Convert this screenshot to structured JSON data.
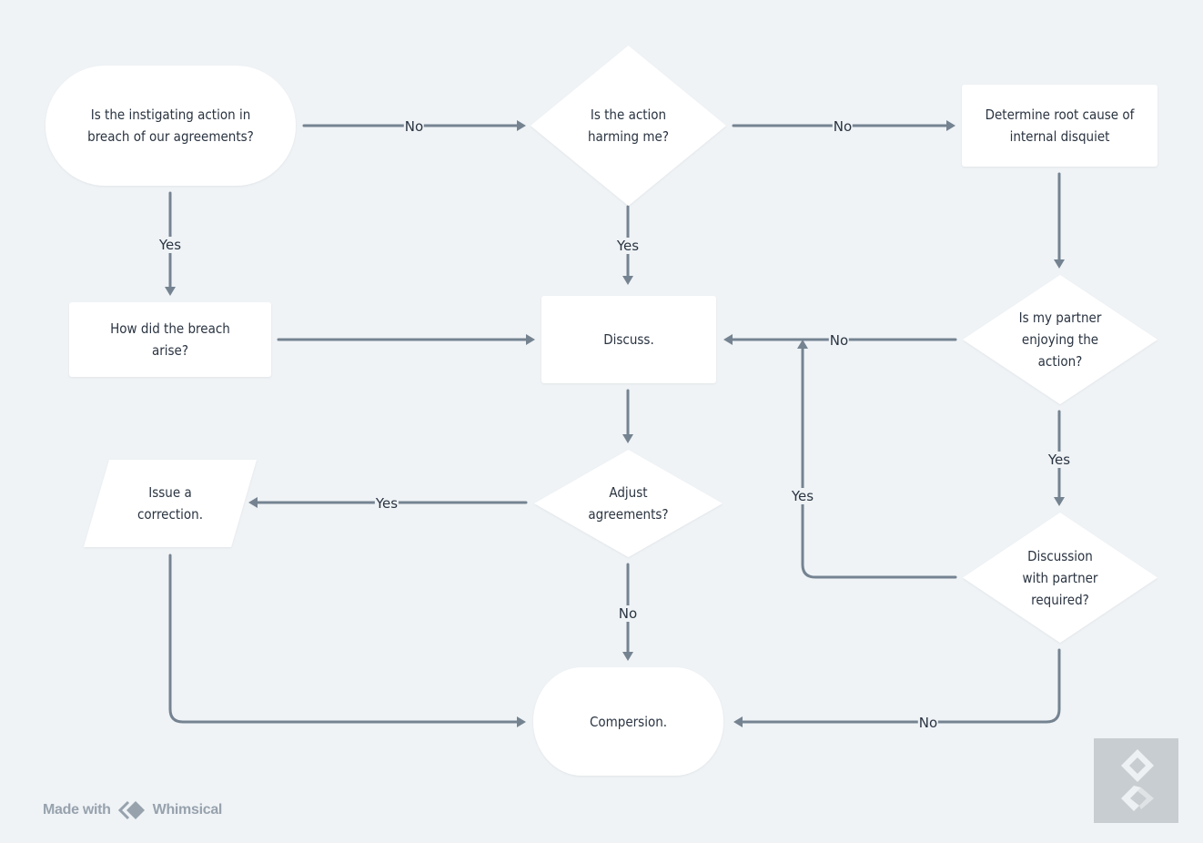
{
  "diagram": {
    "type": "flowchart",
    "colors": {
      "background": "#eff3f6",
      "node_fill": "#ffffff",
      "edge": "#758391",
      "text": "#2a3441"
    },
    "nodes": [
      {
        "id": "n1",
        "shape": "terminal",
        "label": "Is the instigating action in\nbreach of our agreements?"
      },
      {
        "id": "n2",
        "shape": "decision",
        "label": "Is the action\nharming me?"
      },
      {
        "id": "n3",
        "shape": "process",
        "label": "Determine root cause of\ninternal disquiet"
      },
      {
        "id": "n4",
        "shape": "process",
        "label": "How did the breach\narise?"
      },
      {
        "id": "n5",
        "shape": "process",
        "label": "Discuss."
      },
      {
        "id": "n6",
        "shape": "decision",
        "label": "Is my partner\nenjoying the\naction?"
      },
      {
        "id": "n7",
        "shape": "io",
        "label": "Issue a\ncorrection."
      },
      {
        "id": "n8",
        "shape": "decision",
        "label": "Adjust\nagreements?"
      },
      {
        "id": "n9",
        "shape": "decision",
        "label": "Discussion\nwith partner\nrequired?"
      },
      {
        "id": "n10",
        "shape": "terminal",
        "label": "Compersion."
      }
    ],
    "edges": [
      {
        "from": "n1",
        "to": "n2",
        "label": "No"
      },
      {
        "from": "n1",
        "to": "n4",
        "label": "Yes"
      },
      {
        "from": "n2",
        "to": "n3",
        "label": "No"
      },
      {
        "from": "n2",
        "to": "n5",
        "label": "Yes"
      },
      {
        "from": "n3",
        "to": "n6",
        "label": ""
      },
      {
        "from": "n4",
        "to": "n5",
        "label": ""
      },
      {
        "from": "n6",
        "to": "n5",
        "label": "No"
      },
      {
        "from": "n6",
        "to": "n9",
        "label": "Yes"
      },
      {
        "from": "n5",
        "to": "n8",
        "label": ""
      },
      {
        "from": "n8",
        "to": "n7",
        "label": "Yes"
      },
      {
        "from": "n8",
        "to": "n10",
        "label": "No"
      },
      {
        "from": "n9",
        "to": "n5",
        "label": "Yes"
      },
      {
        "from": "n9",
        "to": "n10",
        "label": "No"
      },
      {
        "from": "n7",
        "to": "n10",
        "label": ""
      }
    ]
  },
  "footer": {
    "made_with": "Made with",
    "brand": "Whimsical"
  }
}
